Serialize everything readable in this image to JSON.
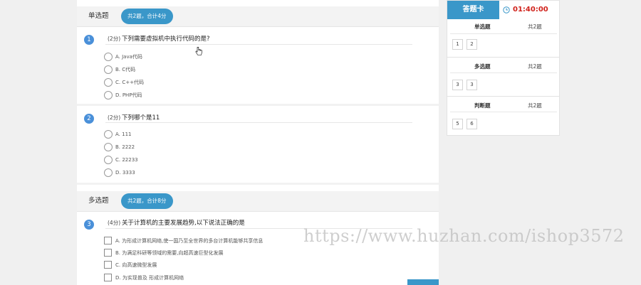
{
  "sections": [
    {
      "title": "单选题",
      "summary": "共2题，合计4分"
    },
    {
      "title": "多选题",
      "summary": "共2题，合计8分"
    }
  ],
  "questions": [
    {
      "num": "1",
      "score": "(2分)",
      "text": "下列需要虚拟机中执行代码的是?",
      "options": [
        "A. Java代码",
        "B. C代码",
        "C. C++代码",
        "D. PHP代码"
      ]
    },
    {
      "num": "2",
      "score": "(2分)",
      "text": "下列哪个是11",
      "options": [
        "A. 111",
        "B. 2222",
        "C. 22233",
        "D. 3333"
      ]
    },
    {
      "num": "3",
      "score": "(4分)",
      "text": "关于计算机的主要发展趋势,以下说法正确的是",
      "options": [
        "A. 为形成计算机网络,使一国乃至全世界的多台计算机能够共享信息",
        "B. 为满足科研等领域的需要,向超高速巨型化发展",
        "C. 向高速微型发展",
        "D. 为实现普及 形成计算机网络"
      ]
    }
  ],
  "answer_card": {
    "title": "答题卡",
    "timer": "01:40:00",
    "sections": [
      {
        "name": "单选题",
        "count": "共2题",
        "items": [
          "1",
          "2"
        ]
      },
      {
        "name": "多选题",
        "count": "共2题",
        "items": [
          "3",
          "3"
        ]
      },
      {
        "name": "判断题",
        "count": "共2题",
        "items": [
          "5",
          "6"
        ]
      }
    ]
  },
  "watermark": "https://www.huzhan.com/ishop3572",
  "colors": {
    "accent": "#3a97c9",
    "number_badge": "#4a90d9",
    "timer": "#d0221b"
  }
}
